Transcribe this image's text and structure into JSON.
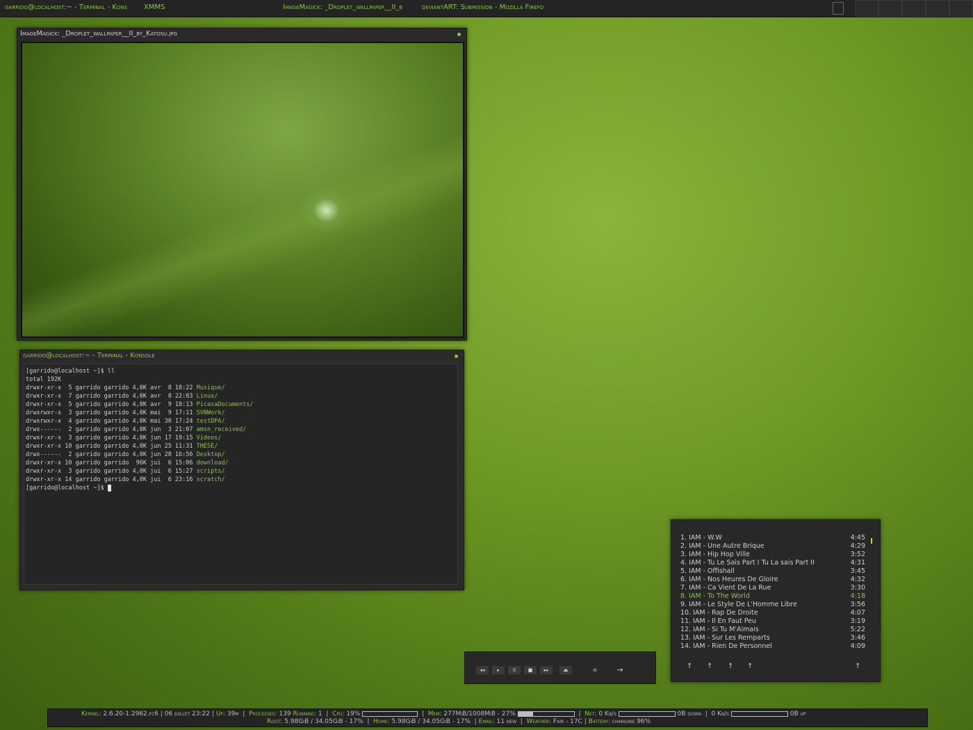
{
  "top_panel": {
    "task_terminal": "garrido@localhost:~ - Terminal - Kons",
    "task_xmms": "XMMS",
    "task_image": "ImageMagick: _Droplet_wallpaper__II_b",
    "task_firefox": "deviantART: Submission - Mozilla Firefo"
  },
  "image_window": {
    "title": "ImageMagick: _Droplet_wallpaper__II_by_Katosu.jpg"
  },
  "terminal": {
    "title": "garrido@localhost:~ - Terminal - Konsole",
    "prompt_cmd": "[garrido@localhost ~]$ ll",
    "total": "total 192K",
    "rows": [
      {
        "meta": "drwxr-xr-x  5 garrido garrido 4,0K avr  8 18:22 ",
        "name": "Musique/"
      },
      {
        "meta": "drwxr-xr-x  7 garrido garrido 4,0K avr  8 22:03 ",
        "name": "Linux/"
      },
      {
        "meta": "drwxr-xr-x  5 garrido garrido 4,0K avr  9 18:13 ",
        "name": "PicasaDocuments/"
      },
      {
        "meta": "drwxrwxr-x  3 garrido garrido 4,0K mai  9 17:11 ",
        "name": "SVNWork/"
      },
      {
        "meta": "drwxrwxr-x  4 garrido garrido 4,0K mai 30 17:24 ",
        "name": "testDPA/"
      },
      {
        "meta": "drwx------  2 garrido garrido 4,0K jun  3 21:07 ",
        "name": "amsn_received/"
      },
      {
        "meta": "drwxr-xr-x  3 garrido garrido 4,0K jun 17 19:15 ",
        "name": "Videos/"
      },
      {
        "meta": "drwxr-xr-x 10 garrido garrido 4,0K jun 25 11:31 ",
        "name": "THESE/"
      },
      {
        "meta": "drwx------  2 garrido garrido 4,0K jun 28 16:56 ",
        "name": "Desktop/"
      },
      {
        "meta": "drwxr-xr-x 10 garrido garrido  96K jui  6 15:06 ",
        "name": "download/"
      },
      {
        "meta": "drwxr-xr-x  3 garrido garrido 4,0K jui  6 15:27 ",
        "name": "scripts/"
      },
      {
        "meta": "drwxr-xr-x 14 garrido garrido 4,0K jui  6 23:16 ",
        "name": "scratch/"
      }
    ],
    "prompt": "[garrido@localhost ~]$ "
  },
  "playlist": {
    "tracks": [
      {
        "name": "1. IAM - W.W",
        "time": "4:45"
      },
      {
        "name": "2. IAM - Une Autre Brique",
        "time": "4:29"
      },
      {
        "name": "3. IAM - Hip Hop Ville",
        "time": "3:52"
      },
      {
        "name": "4. IAM - Tu Le Sais Part I Tu La sais Part II",
        "time": "4:31"
      },
      {
        "name": "5. IAM - Offishall",
        "time": "3:45"
      },
      {
        "name": "6. IAM - Nos Heures De Gloire",
        "time": "4:32"
      },
      {
        "name": "7. IAM - Ca Vient De La Rue",
        "time": "3:30"
      },
      {
        "name": "8. IAM - To The World",
        "time": "4:18"
      },
      {
        "name": "9. IAM - Le Style De L'Homme Libre",
        "time": "3:56"
      },
      {
        "name": "10. IAM - Rap De Droite",
        "time": "4:07"
      },
      {
        "name": "11. IAM - Il En Faut Peu",
        "time": "3:19"
      },
      {
        "name": "12. IAM - Si Tu M'Aimais",
        "time": "5:22"
      },
      {
        "name": "13. IAM - Sur Les Remparts",
        "time": "3:46"
      },
      {
        "name": "14. IAM - Rien De Personnel",
        "time": "4:09"
      }
    ],
    "active_index": 7,
    "buttons": [
      "↑",
      "↑",
      "↑",
      "↑",
      "↑"
    ]
  },
  "player": {
    "buttons": [
      "◂◂",
      "▸",
      "II",
      "■",
      "▸▸",
      "⏏"
    ],
    "eq": "ılı",
    "arrow": "→"
  },
  "status": {
    "kernel_label": "Kernel:",
    "kernel": "2.6.20-1.2962.fc6",
    "date": "06 juillet 23:22",
    "up_label": "Up:",
    "up": "39m",
    "processes_label": "Processes:",
    "processes": "139",
    "running_label": "Running:",
    "running": "1",
    "cpu_label": "Cpu:",
    "cpu": "19%",
    "mem_label": "Mem:",
    "mem": "277MiB/1008MiB - 27%",
    "mem_fraction": 0.27,
    "net_label": "Net:",
    "net_down": "0 Kb/s",
    "down_total": "0B down",
    "net_up": "0 Kb/s",
    "up_total": "0B up",
    "root_label": "Root:",
    "root": "5.98GiB  / 34.05GiB - 17%",
    "home_label": "Home:",
    "home": "5.98GiB  / 34.05GiB  - 17%",
    "email_label": "Email:",
    "email": "11 new",
    "weather_label": "Weather:",
    "weather": "Fair - 17C",
    "battery_label": "Battery:",
    "battery": "charging 96%"
  }
}
